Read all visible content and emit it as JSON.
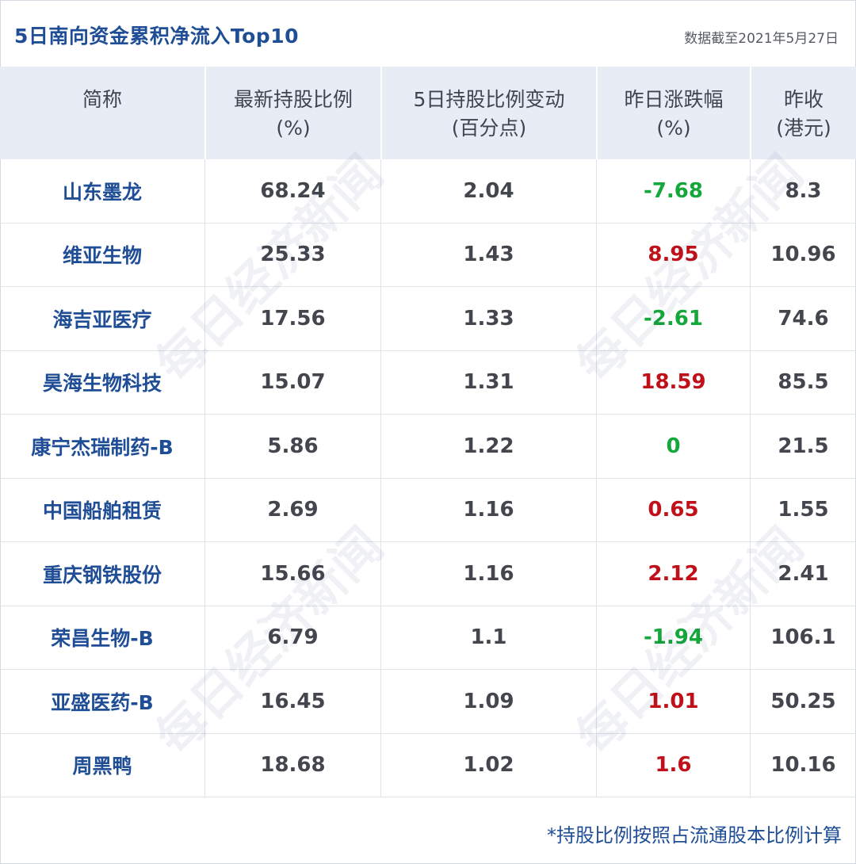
{
  "header": {
    "title": "5日南向资金累积净流入Top10",
    "date": "数据截至2021年5月27日"
  },
  "watermark": "每日经济新闻",
  "chart_data": {
    "type": "table",
    "columns": [
      {
        "line1": "简称",
        "line2": ""
      },
      {
        "line1": "最新持股比例",
        "line2": "(%)"
      },
      {
        "line1": "5日持股比例变动",
        "line2": "(百分点)"
      },
      {
        "line1": "昨日涨跌幅",
        "line2": "(%)"
      },
      {
        "line1": "昨收",
        "line2": "(港元)"
      }
    ],
    "rows": [
      {
        "name": "山东墨龙",
        "holding": "68.24",
        "change": "2.04",
        "pct": "-7.68",
        "close": "8.3"
      },
      {
        "name": "维亚生物",
        "holding": "25.33",
        "change": "1.43",
        "pct": "8.95",
        "close": "10.96"
      },
      {
        "name": "海吉亚医疗",
        "holding": "17.56",
        "change": "1.33",
        "pct": "-2.61",
        "close": "74.6"
      },
      {
        "name": "昊海生物科技",
        "holding": "15.07",
        "change": "1.31",
        "pct": "18.59",
        "close": "85.5"
      },
      {
        "name": "康宁杰瑞制药-B",
        "holding": "5.86",
        "change": "1.22",
        "pct": "0",
        "close": "21.5"
      },
      {
        "name": "中国船舶租赁",
        "holding": "2.69",
        "change": "1.16",
        "pct": "0.65",
        "close": "1.55"
      },
      {
        "name": "重庆钢铁股份",
        "holding": "15.66",
        "change": "1.16",
        "pct": "2.12",
        "close": "2.41"
      },
      {
        "name": "荣昌生物-B",
        "holding": "6.79",
        "change": "1.1",
        "pct": "-1.94",
        "close": "106.1"
      },
      {
        "name": "亚盛医药-B",
        "holding": "16.45",
        "change": "1.09",
        "pct": "1.01",
        "close": "50.25"
      },
      {
        "name": "周黑鸭",
        "holding": "18.68",
        "change": "1.02",
        "pct": "1.6",
        "close": "10.16"
      }
    ],
    "colors": {
      "up": "#c0101a",
      "down": "#14a83a",
      "name": "#1f4e96",
      "header_bg": "#e8ecf5"
    }
  },
  "footnote": "*持股比例按照占流通股本比例计算"
}
